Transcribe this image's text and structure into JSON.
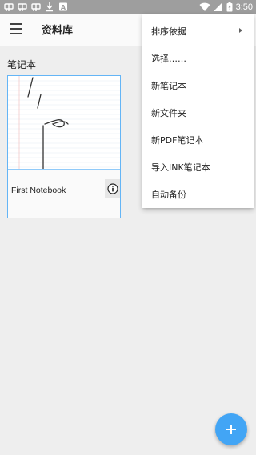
{
  "status_bar": {
    "time": "3:50",
    "left_icons": [
      "bug-icon",
      "bug-icon",
      "bug-icon",
      "download-icon",
      "a-icon"
    ],
    "right_icons": [
      "wifi-icon",
      "signal-icon",
      "battery-icon"
    ]
  },
  "app_bar": {
    "title": "资料库",
    "menu_icon": "hamburger-icon"
  },
  "section": {
    "title": "笔记本"
  },
  "notebooks": [
    {
      "name": "First Notebook",
      "info_icon": "info-icon"
    }
  ],
  "menu": {
    "items": [
      {
        "label": "排序依据",
        "has_submenu": true
      },
      {
        "label": "选择……"
      },
      {
        "label": "新笔记本"
      },
      {
        "label": "新文件夹"
      },
      {
        "label": "新PDF笔记本"
      },
      {
        "label": "导入INK笔记本"
      },
      {
        "label": "自动备份"
      }
    ]
  },
  "fab": {
    "icon": "plus-icon"
  },
  "colors": {
    "status_bar": "#9e9e9e",
    "accent": "#42a5f5",
    "background": "#eeeeee",
    "card_border": "#64b5f6"
  }
}
